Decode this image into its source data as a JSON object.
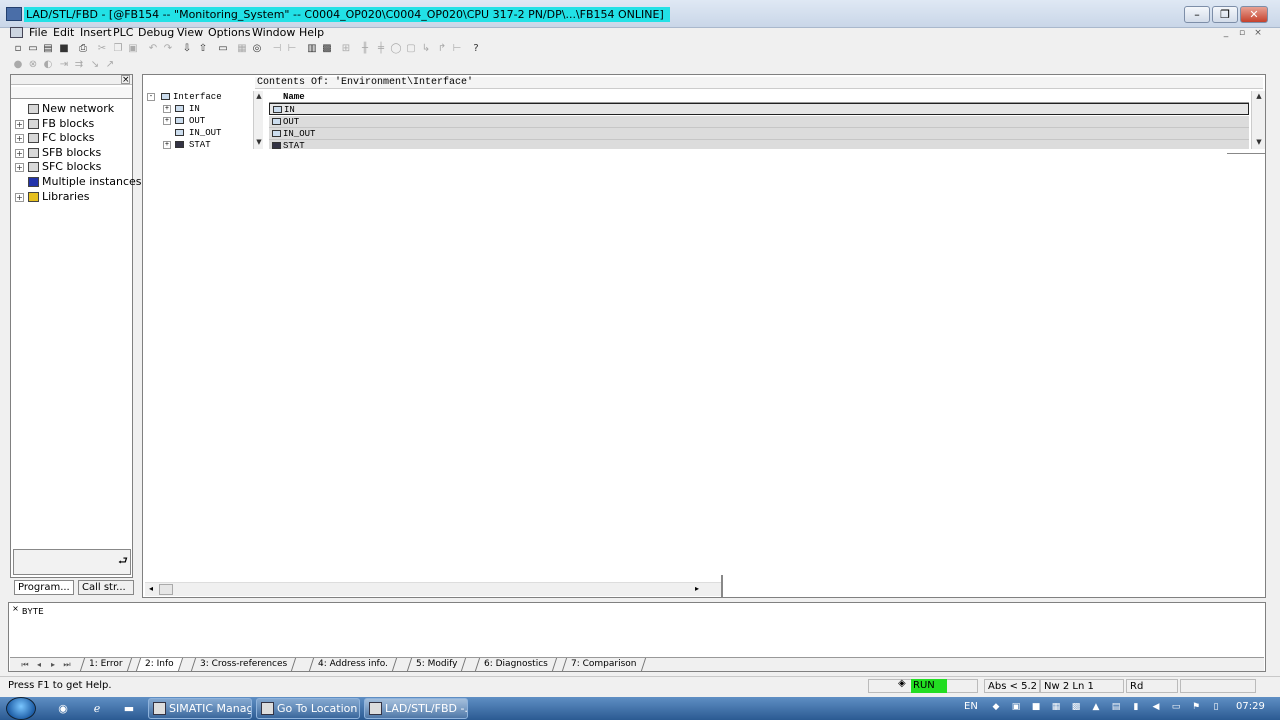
{
  "window": {
    "title": "LAD/STL/FBD  - [@FB154 -- \"Monitoring_System\" -- C0004_OP020\\C0004_OP020\\CPU 317-2 PN/DP\\...\\FB154  ONLINE]",
    "minimize": "–",
    "restore": "❐",
    "close": "✕"
  },
  "menu": [
    "File",
    "Edit",
    "Insert",
    "PLC",
    "Debug",
    "View",
    "Options",
    "Window",
    "Help"
  ],
  "mdi_controls": [
    "_",
    "▫",
    "×"
  ],
  "program_elements": {
    "items": [
      {
        "label": "New network",
        "expand": ""
      },
      {
        "label": "FB blocks",
        "expand": "+"
      },
      {
        "label": "FC blocks",
        "expand": "+"
      },
      {
        "label": "SFB blocks",
        "expand": "+"
      },
      {
        "label": "SFC blocks",
        "expand": "+"
      },
      {
        "label": "Multiple instances",
        "expand": ""
      },
      {
        "label": "Libraries",
        "expand": "+"
      }
    ],
    "tabs": [
      "Program...",
      "Call str..."
    ]
  },
  "declaration": {
    "header": "Contents Of: 'Environment\\Interface'",
    "tree": [
      {
        "label": "Interface",
        "expand": "-"
      },
      {
        "label": "IN",
        "expand": "+"
      },
      {
        "label": "OUT",
        "expand": "+"
      },
      {
        "label": "IN_OUT",
        "expand": ""
      },
      {
        "label": "STAT",
        "expand": "+"
      }
    ],
    "column_header": "Name",
    "rows": [
      "IN",
      "OUT",
      "IN_OUT",
      "STAT"
    ]
  },
  "output": {
    "text": "BYTE",
    "tabs": [
      "1: Error",
      "2: Info",
      "3: Cross-references",
      "4: Address info.",
      "5: Modify",
      "6: Diagnostics",
      "7: Comparison"
    ],
    "active_tab": "2: Info"
  },
  "status": {
    "help": "Press F1 to get Help.",
    "run": "RUN",
    "abs": "Abs < 5.2",
    "network": "Nw 2  Ln 1",
    "mode": "Rd"
  },
  "taskbar": {
    "buttons": [
      "SIMATIC Manag...",
      "Go To Location",
      "LAD/STL/FBD  -..."
    ],
    "language": "EN",
    "clock": "07:29"
  },
  "colors": {
    "title_highlight": "#22e1e6",
    "run_status": "#22dd22"
  }
}
